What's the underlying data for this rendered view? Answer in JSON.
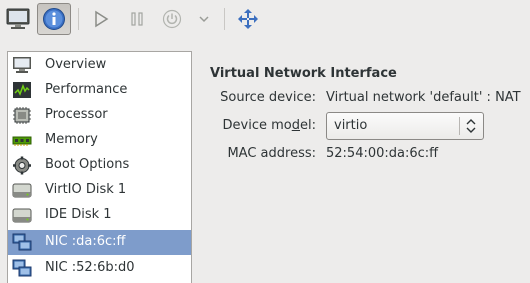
{
  "toolbar": {
    "buttons": [
      {
        "name": "console",
        "icon": "monitor-icon"
      },
      {
        "name": "details",
        "icon": "info-icon",
        "active": true
      },
      {
        "name": "run",
        "icon": "play-icon"
      },
      {
        "name": "pause",
        "icon": "pause-icon"
      },
      {
        "name": "shutdown",
        "icon": "power-icon"
      },
      {
        "name": "shutdown-menu",
        "icon": "chevron-down-icon"
      },
      {
        "name": "fullscreen",
        "icon": "move-arrows-icon"
      }
    ]
  },
  "sidebar": {
    "items": [
      {
        "label": "Overview",
        "icon": "monitor-icon"
      },
      {
        "label": "Performance",
        "icon": "performance-graph-icon"
      },
      {
        "label": "Processor",
        "icon": "cpu-icon"
      },
      {
        "label": "Memory",
        "icon": "memory-icon"
      },
      {
        "label": "Boot Options",
        "icon": "boot-gear-icon"
      },
      {
        "label": "VirtIO Disk 1",
        "icon": "disk-icon"
      },
      {
        "label": "IDE Disk 1",
        "icon": "disk-icon"
      },
      {
        "label": "NIC :da:6c:ff",
        "icon": "network-icon",
        "selected": true
      },
      {
        "label": "NIC :52:6b:d0",
        "icon": "network-icon"
      }
    ]
  },
  "details": {
    "title": "Virtual Network Interface",
    "source_label": "Source device:",
    "source_value": "Virtual network 'default' : NAT",
    "model_label_pre": "Device mo",
    "model_label_mnemonic": "d",
    "model_label_post": "el:",
    "model_value": "virtio",
    "mac_label": "MAC address:",
    "mac_value": "52:54:00:da:6c:ff"
  },
  "colors": {
    "selection": "#7e9ccb",
    "window_bg": "#edeceb"
  }
}
